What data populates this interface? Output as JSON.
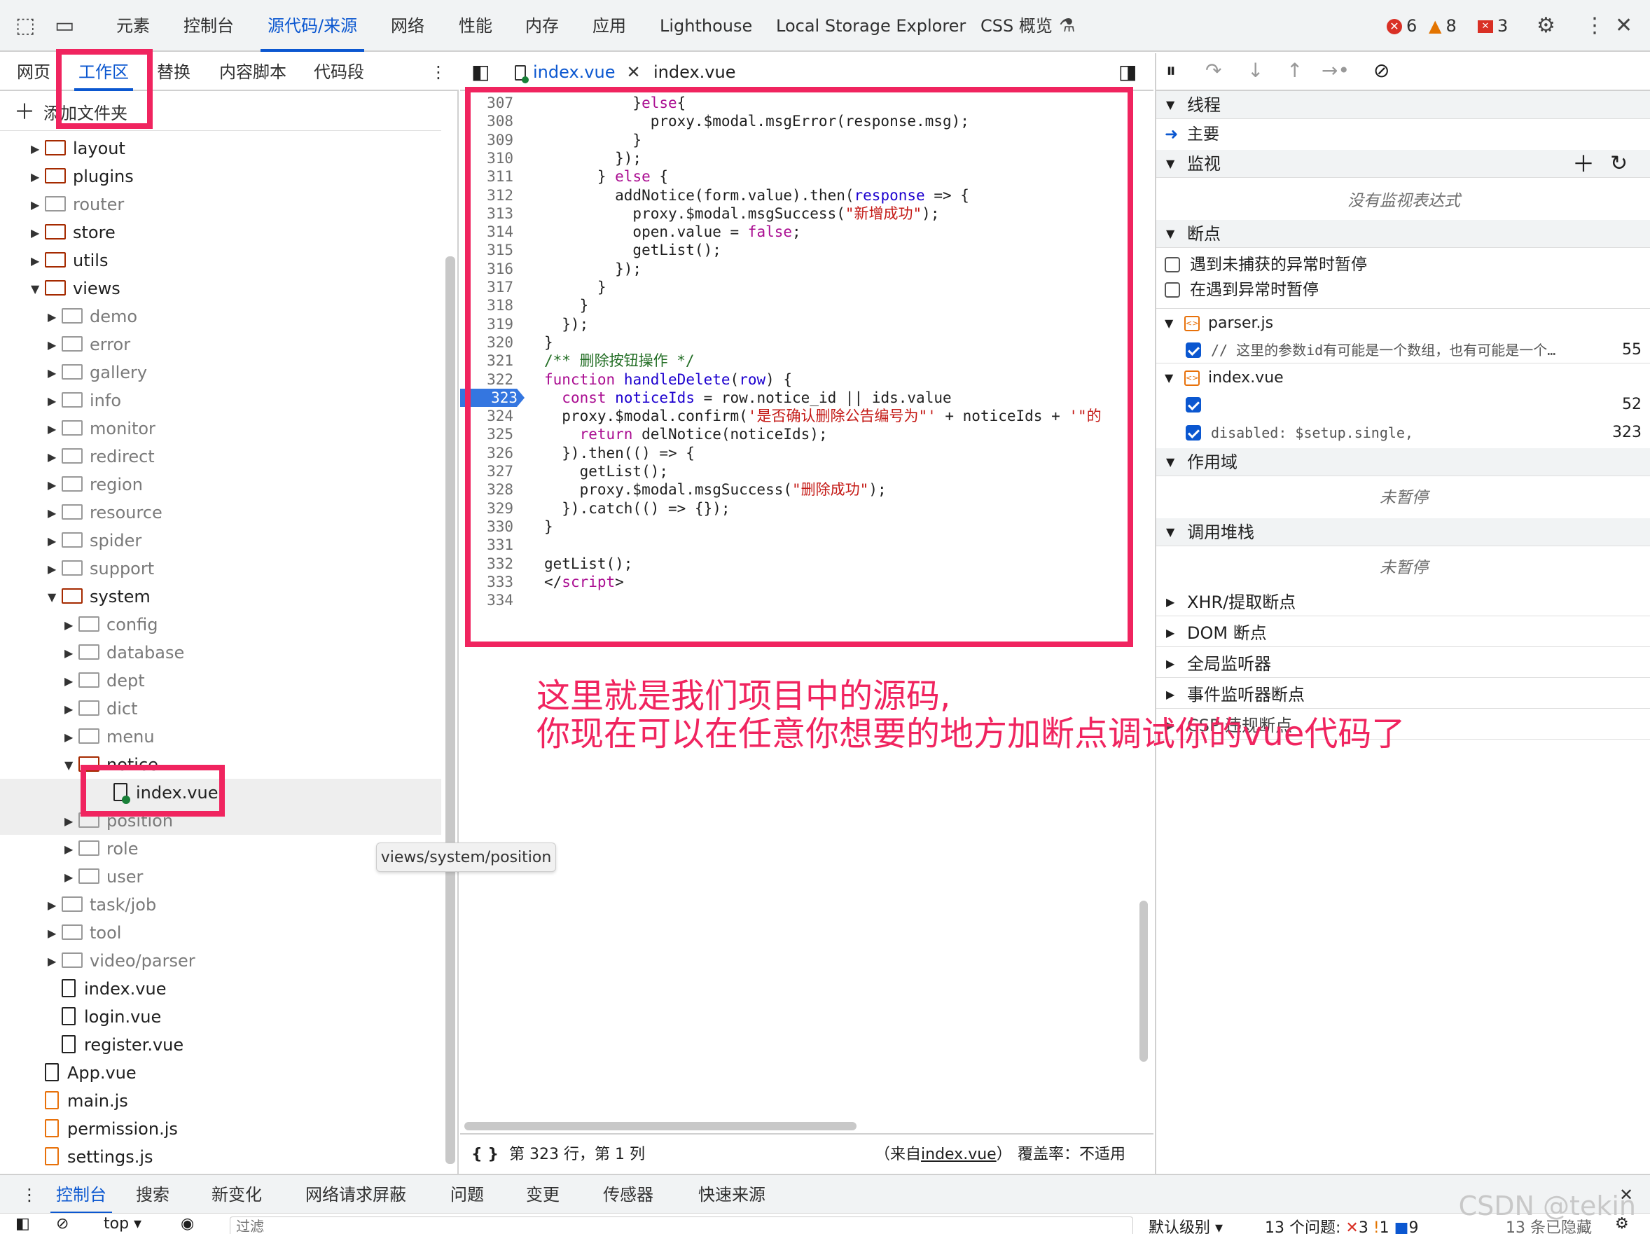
{
  "toolbar": {
    "tabs": [
      "元素",
      "控制台",
      "源代码/来源",
      "网络",
      "性能",
      "内存",
      "应用",
      "Lighthouse",
      "Local Storage Explorer",
      "CSS 概览"
    ],
    "errors": "6",
    "warnings": "8",
    "issues": "3"
  },
  "left": {
    "tabs": [
      "网页",
      "工作区",
      "替换",
      "内容脚本",
      "代码段"
    ],
    "add_folder": "添加文件夹",
    "tree": [
      {
        "label": "layout",
        "type": "folder",
        "indent": 0,
        "open": false,
        "dim": false
      },
      {
        "label": "plugins",
        "type": "folder",
        "indent": 0,
        "open": false,
        "dim": false
      },
      {
        "label": "router",
        "type": "folder",
        "indent": 0,
        "open": false,
        "dim": true
      },
      {
        "label": "store",
        "type": "folder",
        "indent": 0,
        "open": false,
        "dim": false
      },
      {
        "label": "utils",
        "type": "folder",
        "indent": 0,
        "open": false,
        "dim": false
      },
      {
        "label": "views",
        "type": "folder",
        "indent": 0,
        "open": true,
        "dim": false
      },
      {
        "label": "demo",
        "type": "folder",
        "indent": 1,
        "open": false,
        "dim": true
      },
      {
        "label": "error",
        "type": "folder",
        "indent": 1,
        "open": false,
        "dim": true
      },
      {
        "label": "gallery",
        "type": "folder",
        "indent": 1,
        "open": false,
        "dim": true
      },
      {
        "label": "info",
        "type": "folder",
        "indent": 1,
        "open": false,
        "dim": true
      },
      {
        "label": "monitor",
        "type": "folder",
        "indent": 1,
        "open": false,
        "dim": true
      },
      {
        "label": "redirect",
        "type": "folder",
        "indent": 1,
        "open": false,
        "dim": true
      },
      {
        "label": "region",
        "type": "folder",
        "indent": 1,
        "open": false,
        "dim": true
      },
      {
        "label": "resource",
        "type": "folder",
        "indent": 1,
        "open": false,
        "dim": true
      },
      {
        "label": "spider",
        "type": "folder",
        "indent": 1,
        "open": false,
        "dim": true
      },
      {
        "label": "support",
        "type": "folder",
        "indent": 1,
        "open": false,
        "dim": true
      },
      {
        "label": "system",
        "type": "folder",
        "indent": 1,
        "open": true,
        "dim": false
      },
      {
        "label": "config",
        "type": "folder",
        "indent": 2,
        "open": false,
        "dim": true
      },
      {
        "label": "database",
        "type": "folder",
        "indent": 2,
        "open": false,
        "dim": true
      },
      {
        "label": "dept",
        "type": "folder",
        "indent": 2,
        "open": false,
        "dim": true
      },
      {
        "label": "dict",
        "type": "folder",
        "indent": 2,
        "open": false,
        "dim": true
      },
      {
        "label": "menu",
        "type": "folder",
        "indent": 2,
        "open": false,
        "dim": true
      },
      {
        "label": "notice",
        "type": "folder",
        "indent": 2,
        "open": true,
        "dim": false
      },
      {
        "label": "index.vue",
        "type": "file-dot",
        "indent": 3,
        "open": false,
        "dim": false
      },
      {
        "label": "position",
        "type": "folder",
        "indent": 2,
        "open": false,
        "dim": true
      },
      {
        "label": "role",
        "type": "folder",
        "indent": 2,
        "open": false,
        "dim": true
      },
      {
        "label": "user",
        "type": "folder",
        "indent": 2,
        "open": false,
        "dim": true
      },
      {
        "label": "task/job",
        "type": "folder",
        "indent": 1,
        "open": false,
        "dim": true
      },
      {
        "label": "tool",
        "type": "folder",
        "indent": 1,
        "open": false,
        "dim": true
      },
      {
        "label": "video/parser",
        "type": "folder",
        "indent": 1,
        "open": false,
        "dim": true
      },
      {
        "label": "index.vue",
        "type": "file",
        "indent": 1,
        "open": false,
        "dim": false
      },
      {
        "label": "login.vue",
        "type": "file",
        "indent": 1,
        "open": false,
        "dim": false
      },
      {
        "label": "register.vue",
        "type": "file",
        "indent": 1,
        "open": false,
        "dim": false
      },
      {
        "label": "App.vue",
        "type": "file",
        "indent": 0,
        "open": false,
        "dim": false
      },
      {
        "label": "main.js",
        "type": "file-js",
        "indent": 0,
        "open": false,
        "dim": false
      },
      {
        "label": "permission.js",
        "type": "file-js",
        "indent": 0,
        "open": false,
        "dim": false
      },
      {
        "label": "settings.js",
        "type": "file-js",
        "indent": 0,
        "open": false,
        "dim": false
      }
    ],
    "tooltip": "views/system/position"
  },
  "editor": {
    "tabs": [
      "index.vue",
      "index.vue"
    ],
    "breakpoint_line": "323",
    "lines": [
      {
        "n": "307",
        "html": "          }<span class=\"kw\">else</span>{"
      },
      {
        "n": "308",
        "html": "            proxy.$modal.msgError(response.msg);"
      },
      {
        "n": "309",
        "html": "          }"
      },
      {
        "n": "310",
        "html": "        });"
      },
      {
        "n": "311",
        "html": "      } <span class=\"kw\">else</span> {"
      },
      {
        "n": "312",
        "html": "        addNotice(form.value).then(<span class=\"fn\">response</span> => {"
      },
      {
        "n": "313",
        "html": "          proxy.$modal.msgSuccess(<span class=\"st\">\"新增成功\"</span>);"
      },
      {
        "n": "314",
        "html": "          open.value = <span class=\"kw\">false</span>;"
      },
      {
        "n": "315",
        "html": "          getList();"
      },
      {
        "n": "316",
        "html": "        });"
      },
      {
        "n": "317",
        "html": "      }"
      },
      {
        "n": "318",
        "html": "    }"
      },
      {
        "n": "319",
        "html": "  });"
      },
      {
        "n": "320",
        "html": "}"
      },
      {
        "n": "321",
        "html": "<span class=\"cm\">/** 删除按钮操作 */</span>"
      },
      {
        "n": "322",
        "html": "<span class=\"kw\">function</span> <span class=\"fn\">handleDelete</span>(<span class=\"fn\">row</span>) {"
      },
      {
        "n": "323",
        "html": "  <span class=\"kw\">const</span> <span class=\"fn\">noticeIds</span> = row.notice_id || ids.value"
      },
      {
        "n": "324",
        "html": "  proxy.$modal.confirm(<span class=\"st\">'是否确认删除公告编号为\"'</span> + noticeIds + <span class=\"st\">'\"的</span>"
      },
      {
        "n": "325",
        "html": "    <span class=\"kw\">return</span> delNotice(noticeIds);"
      },
      {
        "n": "326",
        "html": "  }).then(() => {"
      },
      {
        "n": "327",
        "html": "    getList();"
      },
      {
        "n": "328",
        "html": "    proxy.$modal.msgSuccess(<span class=\"st\">\"删除成功\"</span>);"
      },
      {
        "n": "329",
        "html": "  }).catch(() => {});"
      },
      {
        "n": "330",
        "html": "}"
      },
      {
        "n": "331",
        "html": ""
      },
      {
        "n": "332",
        "html": "getList();"
      },
      {
        "n": "333",
        "html": "&lt;/<span class=\"kw\">script</span>&gt;"
      },
      {
        "n": "334",
        "html": ""
      }
    ],
    "status_pos": "第 323 行，第 1 列",
    "status_from": "（来自",
    "status_file": "index.vue",
    "status_close": "）",
    "status_coverage": "覆盖率：不适用"
  },
  "right": {
    "threads": "线程",
    "main": "主要",
    "watch": "监视",
    "watch_empty": "没有监视表达式",
    "breakpoints": "断点",
    "pause_uncaught": "遇到未捕获的异常时暂停",
    "pause_caught": "在遇到异常时暂停",
    "bp_files": [
      {
        "file": "parser.js",
        "items": [
          {
            "text": "// 这里的参数id有可能是一个数组，也有可能是一个…",
            "line": "55"
          }
        ]
      },
      {
        "file": "index.vue",
        "items": [
          {
            "text": "",
            "line": "52"
          },
          {
            "text": "disabled: $setup.single,",
            "line": "323"
          }
        ]
      }
    ],
    "scope": "作用域",
    "scope_empty": "未暂停",
    "callstack": "调用堆栈",
    "callstack_empty": "未暂停",
    "xhr": "XHR/提取断点",
    "dom": "DOM 断点",
    "global": "全局监听器",
    "event": "事件监听器断点",
    "csp": "CSP 违规断点"
  },
  "bottom": {
    "tabs": [
      "控制台",
      "搜索",
      "新变化",
      "网络请求屏蔽",
      "问题",
      "变更",
      "传感器",
      "快速来源"
    ],
    "context": "top",
    "filter_placeholder": "过滤",
    "level": "默认级别",
    "issues_label": "13 个问题:",
    "issue_err": "3",
    "issue_warn": "1",
    "issue_info": "9",
    "hidden": "13 条已隐藏"
  },
  "annotation": {
    "line1": "这里就是我们项目中的源码,",
    "line2": "你现在可以在任意你想要的地方加断点调试你的vue代码了"
  },
  "watermark": "CSDN @tekin",
  "colors": {
    "accent": "#0b57d0",
    "highlight": "#f0245f"
  }
}
